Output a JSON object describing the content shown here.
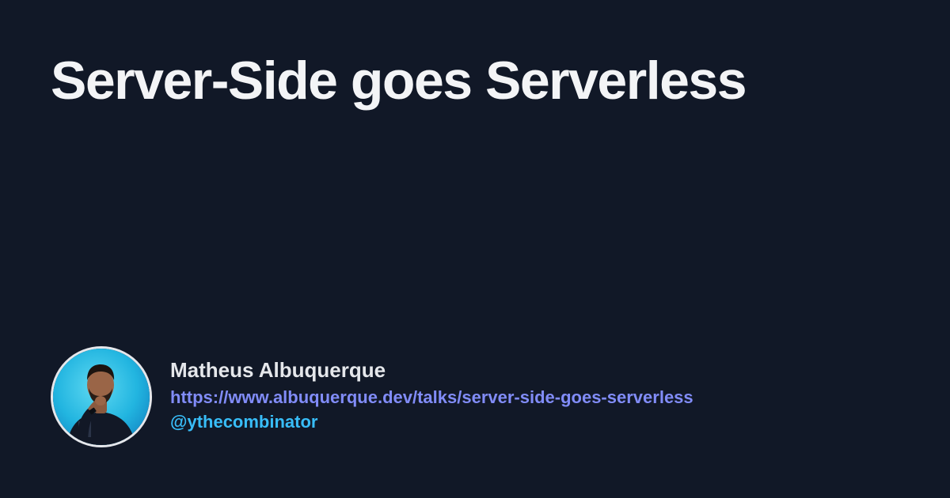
{
  "title": "Server-Side goes Serverless",
  "author": {
    "name": "Matheus Albuquerque",
    "url": "https://www.albuquerque.dev/talks/server-side-goes-serverless",
    "handle": "@ythecombinator"
  },
  "colors": {
    "background": "#111827",
    "title": "#f3f4f6",
    "url": "#818cf8",
    "handle": "#38bdf8"
  },
  "icons": {
    "avatar": "person-avatar-photo"
  }
}
